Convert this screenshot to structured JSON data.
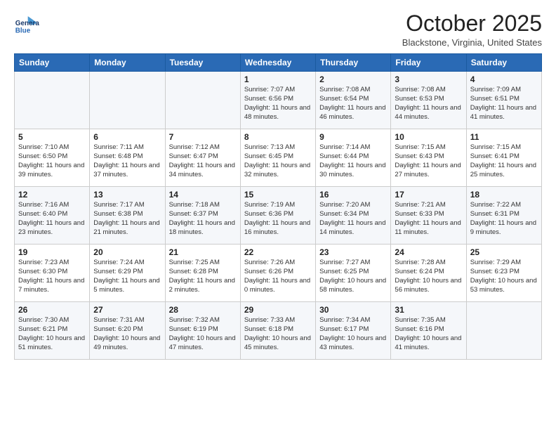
{
  "header": {
    "logo_line1": "General",
    "logo_line2": "Blue",
    "month": "October 2025",
    "location": "Blackstone, Virginia, United States"
  },
  "days_of_week": [
    "Sunday",
    "Monday",
    "Tuesday",
    "Wednesday",
    "Thursday",
    "Friday",
    "Saturday"
  ],
  "weeks": [
    [
      {
        "day": "",
        "info": ""
      },
      {
        "day": "",
        "info": ""
      },
      {
        "day": "",
        "info": ""
      },
      {
        "day": "1",
        "info": "Sunrise: 7:07 AM\nSunset: 6:56 PM\nDaylight: 11 hours and 48 minutes."
      },
      {
        "day": "2",
        "info": "Sunrise: 7:08 AM\nSunset: 6:54 PM\nDaylight: 11 hours and 46 minutes."
      },
      {
        "day": "3",
        "info": "Sunrise: 7:08 AM\nSunset: 6:53 PM\nDaylight: 11 hours and 44 minutes."
      },
      {
        "day": "4",
        "info": "Sunrise: 7:09 AM\nSunset: 6:51 PM\nDaylight: 11 hours and 41 minutes."
      }
    ],
    [
      {
        "day": "5",
        "info": "Sunrise: 7:10 AM\nSunset: 6:50 PM\nDaylight: 11 hours and 39 minutes."
      },
      {
        "day": "6",
        "info": "Sunrise: 7:11 AM\nSunset: 6:48 PM\nDaylight: 11 hours and 37 minutes."
      },
      {
        "day": "7",
        "info": "Sunrise: 7:12 AM\nSunset: 6:47 PM\nDaylight: 11 hours and 34 minutes."
      },
      {
        "day": "8",
        "info": "Sunrise: 7:13 AM\nSunset: 6:45 PM\nDaylight: 11 hours and 32 minutes."
      },
      {
        "day": "9",
        "info": "Sunrise: 7:14 AM\nSunset: 6:44 PM\nDaylight: 11 hours and 30 minutes."
      },
      {
        "day": "10",
        "info": "Sunrise: 7:15 AM\nSunset: 6:43 PM\nDaylight: 11 hours and 27 minutes."
      },
      {
        "day": "11",
        "info": "Sunrise: 7:15 AM\nSunset: 6:41 PM\nDaylight: 11 hours and 25 minutes."
      }
    ],
    [
      {
        "day": "12",
        "info": "Sunrise: 7:16 AM\nSunset: 6:40 PM\nDaylight: 11 hours and 23 minutes."
      },
      {
        "day": "13",
        "info": "Sunrise: 7:17 AM\nSunset: 6:38 PM\nDaylight: 11 hours and 21 minutes."
      },
      {
        "day": "14",
        "info": "Sunrise: 7:18 AM\nSunset: 6:37 PM\nDaylight: 11 hours and 18 minutes."
      },
      {
        "day": "15",
        "info": "Sunrise: 7:19 AM\nSunset: 6:36 PM\nDaylight: 11 hours and 16 minutes."
      },
      {
        "day": "16",
        "info": "Sunrise: 7:20 AM\nSunset: 6:34 PM\nDaylight: 11 hours and 14 minutes."
      },
      {
        "day": "17",
        "info": "Sunrise: 7:21 AM\nSunset: 6:33 PM\nDaylight: 11 hours and 11 minutes."
      },
      {
        "day": "18",
        "info": "Sunrise: 7:22 AM\nSunset: 6:31 PM\nDaylight: 11 hours and 9 minutes."
      }
    ],
    [
      {
        "day": "19",
        "info": "Sunrise: 7:23 AM\nSunset: 6:30 PM\nDaylight: 11 hours and 7 minutes."
      },
      {
        "day": "20",
        "info": "Sunrise: 7:24 AM\nSunset: 6:29 PM\nDaylight: 11 hours and 5 minutes."
      },
      {
        "day": "21",
        "info": "Sunrise: 7:25 AM\nSunset: 6:28 PM\nDaylight: 11 hours and 2 minutes."
      },
      {
        "day": "22",
        "info": "Sunrise: 7:26 AM\nSunset: 6:26 PM\nDaylight: 11 hours and 0 minutes."
      },
      {
        "day": "23",
        "info": "Sunrise: 7:27 AM\nSunset: 6:25 PM\nDaylight: 10 hours and 58 minutes."
      },
      {
        "day": "24",
        "info": "Sunrise: 7:28 AM\nSunset: 6:24 PM\nDaylight: 10 hours and 56 minutes."
      },
      {
        "day": "25",
        "info": "Sunrise: 7:29 AM\nSunset: 6:23 PM\nDaylight: 10 hours and 53 minutes."
      }
    ],
    [
      {
        "day": "26",
        "info": "Sunrise: 7:30 AM\nSunset: 6:21 PM\nDaylight: 10 hours and 51 minutes."
      },
      {
        "day": "27",
        "info": "Sunrise: 7:31 AM\nSunset: 6:20 PM\nDaylight: 10 hours and 49 minutes."
      },
      {
        "day": "28",
        "info": "Sunrise: 7:32 AM\nSunset: 6:19 PM\nDaylight: 10 hours and 47 minutes."
      },
      {
        "day": "29",
        "info": "Sunrise: 7:33 AM\nSunset: 6:18 PM\nDaylight: 10 hours and 45 minutes."
      },
      {
        "day": "30",
        "info": "Sunrise: 7:34 AM\nSunset: 6:17 PM\nDaylight: 10 hours and 43 minutes."
      },
      {
        "day": "31",
        "info": "Sunrise: 7:35 AM\nSunset: 6:16 PM\nDaylight: 10 hours and 41 minutes."
      },
      {
        "day": "",
        "info": ""
      }
    ]
  ]
}
